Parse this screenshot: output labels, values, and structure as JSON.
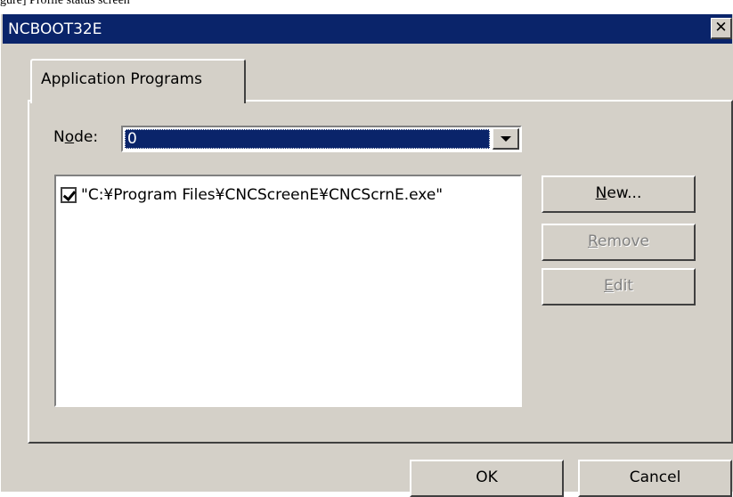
{
  "caption_fragment": "gure] Profile status screen",
  "window": {
    "title": "NCBOOT32E",
    "close_glyph": "✕"
  },
  "tabs": [
    {
      "label": "Application Programs",
      "selected": true
    }
  ],
  "node": {
    "label_pre": "N",
    "label_access": "o",
    "label_post": "de:",
    "value": "0"
  },
  "programs": [
    {
      "checked": true,
      "path": "\"C:¥Program Files¥CNCScreenE¥CNCScrnE.exe\""
    }
  ],
  "buttons": {
    "new": {
      "access": "N",
      "rest": "ew...",
      "enabled": true
    },
    "remove": {
      "access": "R",
      "rest": "emove",
      "enabled": false
    },
    "edit": {
      "access": "E",
      "rest": "dit",
      "enabled": false
    },
    "ok": {
      "label": "OK"
    },
    "cancel": {
      "label": "Cancel"
    }
  },
  "colors": {
    "titlebar": "#0a246a",
    "face": "#d4d0c8",
    "selection": "#0a246a"
  }
}
